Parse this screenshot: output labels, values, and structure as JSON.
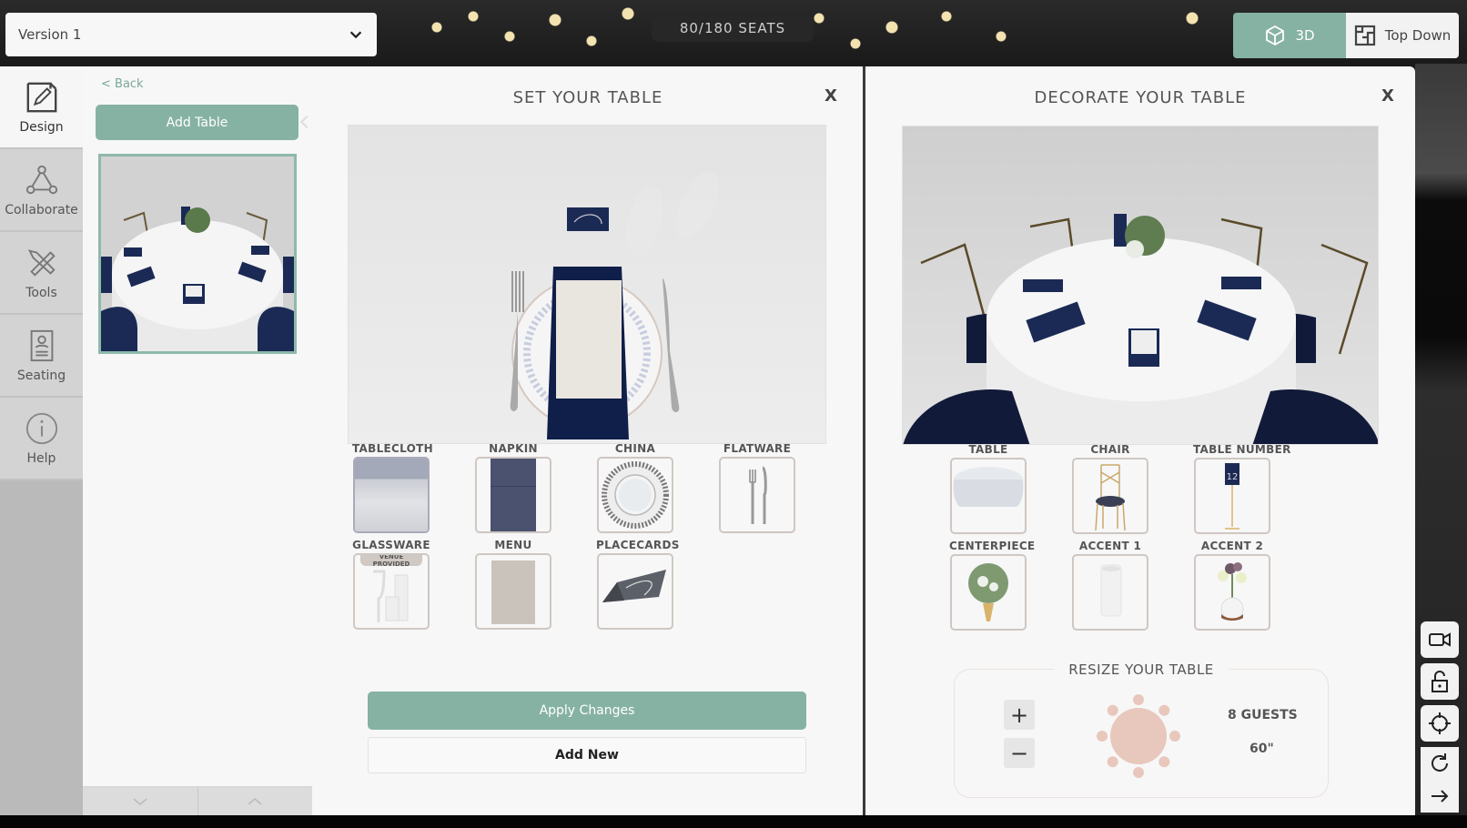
{
  "header": {
    "version_select": {
      "value": "Version 1"
    },
    "seats": "80/180 SEATS",
    "view_toggle": [
      {
        "label": "3D",
        "icon": "cube-icon",
        "active": true
      },
      {
        "label": "Top Down",
        "icon": "floorplan-icon",
        "active": false
      }
    ]
  },
  "nav": {
    "items": [
      {
        "label": "Design",
        "icon": "pencil-icon",
        "active": true
      },
      {
        "label": "Collaborate",
        "icon": "network-icon",
        "active": false
      },
      {
        "label": "Tools",
        "icon": "tools-icon",
        "active": false
      },
      {
        "label": "Seating",
        "icon": "seating-card-icon",
        "active": false
      },
      {
        "label": "Help",
        "icon": "info-icon",
        "active": false
      }
    ]
  },
  "left_panel": {
    "back_label": "< Back",
    "add_table_label": "Add Table"
  },
  "set_panel": {
    "title": "SET YOUR TABLE",
    "close": "X",
    "items": [
      {
        "label": "TABLECLOTH"
      },
      {
        "label": "NAPKIN"
      },
      {
        "label": "CHINA"
      },
      {
        "label": "FLATWARE"
      },
      {
        "label": "GLASSWARE",
        "badge": "VENUE PROVIDED"
      },
      {
        "label": "MENU"
      },
      {
        "label": "PLACECARDS"
      }
    ],
    "apply_label": "Apply Changes",
    "add_new_label": "Add New"
  },
  "decorate_panel": {
    "title": "DECORATE YOUR TABLE",
    "close": "X",
    "items": [
      {
        "label": "TABLE"
      },
      {
        "label": "CHAIR"
      },
      {
        "label": "TABLE NUMBER"
      },
      {
        "label": "CENTERPIECE"
      },
      {
        "label": "ACCENT 1"
      },
      {
        "label": "ACCENT 2"
      }
    ],
    "resize": {
      "title": "RESIZE YOUR TABLE",
      "plus": "+",
      "minus": "−",
      "guests": "8 GUESTS",
      "size": "60\""
    }
  },
  "tools": [
    "video-camera-icon",
    "unlock-icon",
    "crosshair-icon",
    "rotate-icon",
    "arrow-right-icon"
  ],
  "colors": {
    "accent": "#86b2a4",
    "navy": "#1b2a55",
    "table_preview": "#e8c7bc"
  }
}
